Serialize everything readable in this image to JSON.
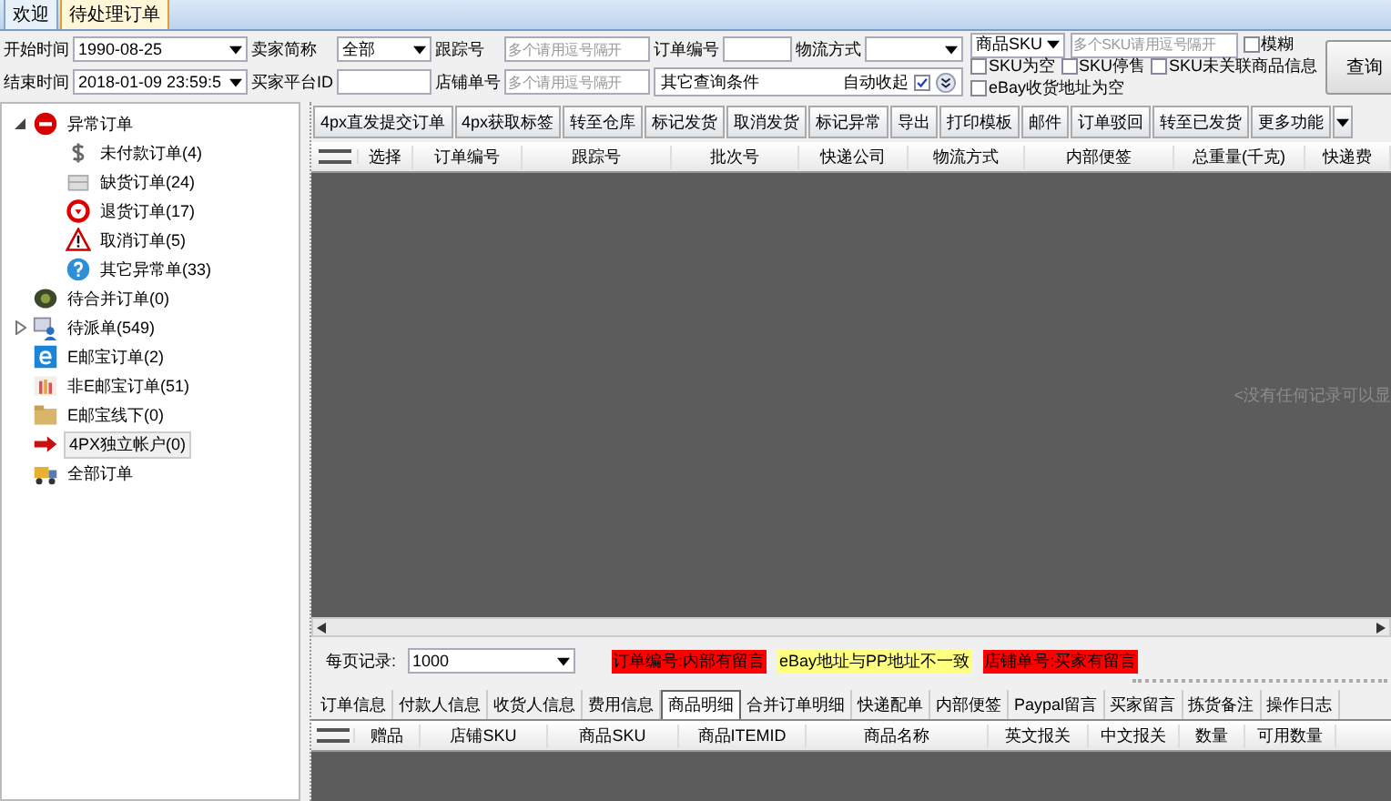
{
  "tabs": [
    {
      "label": "欢迎",
      "selected": false
    },
    {
      "label": "待处理订单",
      "selected": true
    }
  ],
  "filters": {
    "start_label": "开始时间",
    "start_value": "1990-08-25",
    "end_label": "结束时间",
    "end_value": "2018-01-09 23:59:5",
    "seller_label": "卖家简称",
    "seller_value": "全部",
    "buyer_id_label": "买家平台ID",
    "tracking_label": "跟踪号",
    "tracking_placeholder": "多个请用逗号隔开",
    "shop_no_label": "店铺单号",
    "shop_no_placeholder": "多个请用逗号隔开",
    "order_no_label": "订单编号",
    "shipping_label": "物流方式",
    "more_conditions": "其它查询条件",
    "auto_collapse_label": "自动收起",
    "auto_collapse_checked": true,
    "sku_type": "商品SKU",
    "sku_placeholder": "多个SKU请用逗号隔开",
    "checks": [
      {
        "label": "模糊",
        "checked": false
      },
      {
        "label": "SKU为空",
        "checked": false
      },
      {
        "label": "SKU停售",
        "checked": false
      },
      {
        "label": "SKU未关联商品信息",
        "checked": false
      },
      {
        "label": "eBay收货地址为空",
        "checked": false
      }
    ],
    "query_button": "查询"
  },
  "tree": [
    {
      "label": "异常订单",
      "kind": "stop",
      "expanded": true,
      "selected": false,
      "children": [
        {
          "label": "未付款订单(4)",
          "kind": "dollar",
          "selected": false
        },
        {
          "label": "缺货订单(24)",
          "kind": "box",
          "selected": false
        },
        {
          "label": "退货订单(17)",
          "kind": "return",
          "selected": false
        },
        {
          "label": "取消订单(5)",
          "kind": "warning",
          "selected": false
        },
        {
          "label": "其它异常单(33)",
          "kind": "question",
          "selected": false
        }
      ]
    },
    {
      "label": "待合并订单(0)",
      "kind": "merge",
      "selected": false
    },
    {
      "label": "待派单(549)",
      "kind": "dispatch",
      "expanded": false,
      "selected": false
    },
    {
      "label": "E邮宝订单(2)",
      "kind": "e",
      "selected": false
    },
    {
      "label": "非E邮宝订单(51)",
      "kind": "bars",
      "selected": false
    },
    {
      "label": "E邮宝线下(0)",
      "kind": "folder",
      "selected": false
    },
    {
      "label": "4PX独立帐户(0)",
      "kind": "arrow",
      "selected": true
    },
    {
      "label": "全部订单",
      "kind": "truck",
      "selected": false
    }
  ],
  "toolbar": [
    "4px直发提交订单",
    "4px获取标签",
    "转至仓库",
    "标记发货",
    "取消发货",
    "标记异常",
    "导出",
    "打印模板",
    "邮件",
    "订单驳回",
    "转至已发货",
    "更多功能"
  ],
  "order_table": {
    "columns": [
      "选择",
      "订单编号",
      "跟踪号",
      "批次号",
      "快递公司",
      "物流方式",
      "内部便签",
      "总重量(千克)",
      "快递费"
    ],
    "empty_message": "<没有任何记录可以显"
  },
  "page_size": {
    "label": "每页记录:",
    "value": "1000"
  },
  "legend": [
    {
      "label": "订单编号:内部有留言",
      "color": "#ff0000"
    },
    {
      "label": "eBay地址与PP地址不一致",
      "color": "#ffff80"
    },
    {
      "label": "店铺单号:买家有留言",
      "color": "#ff0000"
    }
  ],
  "detail_tabs": [
    {
      "label": "订单信息",
      "selected": false
    },
    {
      "label": "付款人信息",
      "selected": false
    },
    {
      "label": "收货人信息",
      "selected": false
    },
    {
      "label": "费用信息",
      "selected": false
    },
    {
      "label": "商品明细",
      "selected": true
    },
    {
      "label": "合并订单明细",
      "selected": false
    },
    {
      "label": "快递配单",
      "selected": false
    },
    {
      "label": "内部便签",
      "selected": false
    },
    {
      "label": "Paypal留言",
      "selected": false
    },
    {
      "label": "买家留言",
      "selected": false
    },
    {
      "label": "拣货备注",
      "selected": false
    },
    {
      "label": "操作日志",
      "selected": false
    }
  ],
  "detail_table": {
    "columns": [
      "赠品",
      "店铺SKU",
      "商品SKU",
      "商品ITEMID",
      "商品名称",
      "英文报关",
      "中文报关",
      "数量",
      "可用数量"
    ]
  }
}
